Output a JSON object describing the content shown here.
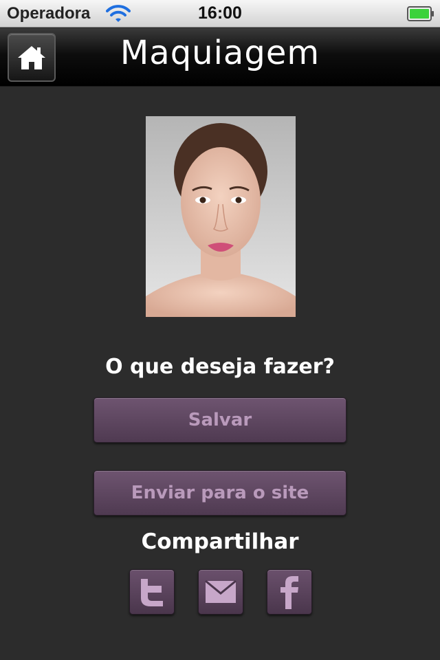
{
  "status_bar": {
    "carrier": "Operadora",
    "time": "16:00",
    "wifi_icon": "wifi-icon",
    "battery_icon": "battery-full-icon",
    "battery_color": "#3cd23c"
  },
  "nav": {
    "title": "Maquiagem",
    "home_icon": "home-icon"
  },
  "main": {
    "question": "O que deseja fazer?",
    "save_label": "Salvar",
    "send_label": "Enviar para o site",
    "share_title": "Compartilhar",
    "share_icons": [
      "twitter-icon",
      "mail-icon",
      "facebook-icon"
    ]
  },
  "colors": {
    "background": "#2c2c2c",
    "button": "#5e4660",
    "button_text": "#b99abb",
    "icon": "#c7a7c9"
  }
}
